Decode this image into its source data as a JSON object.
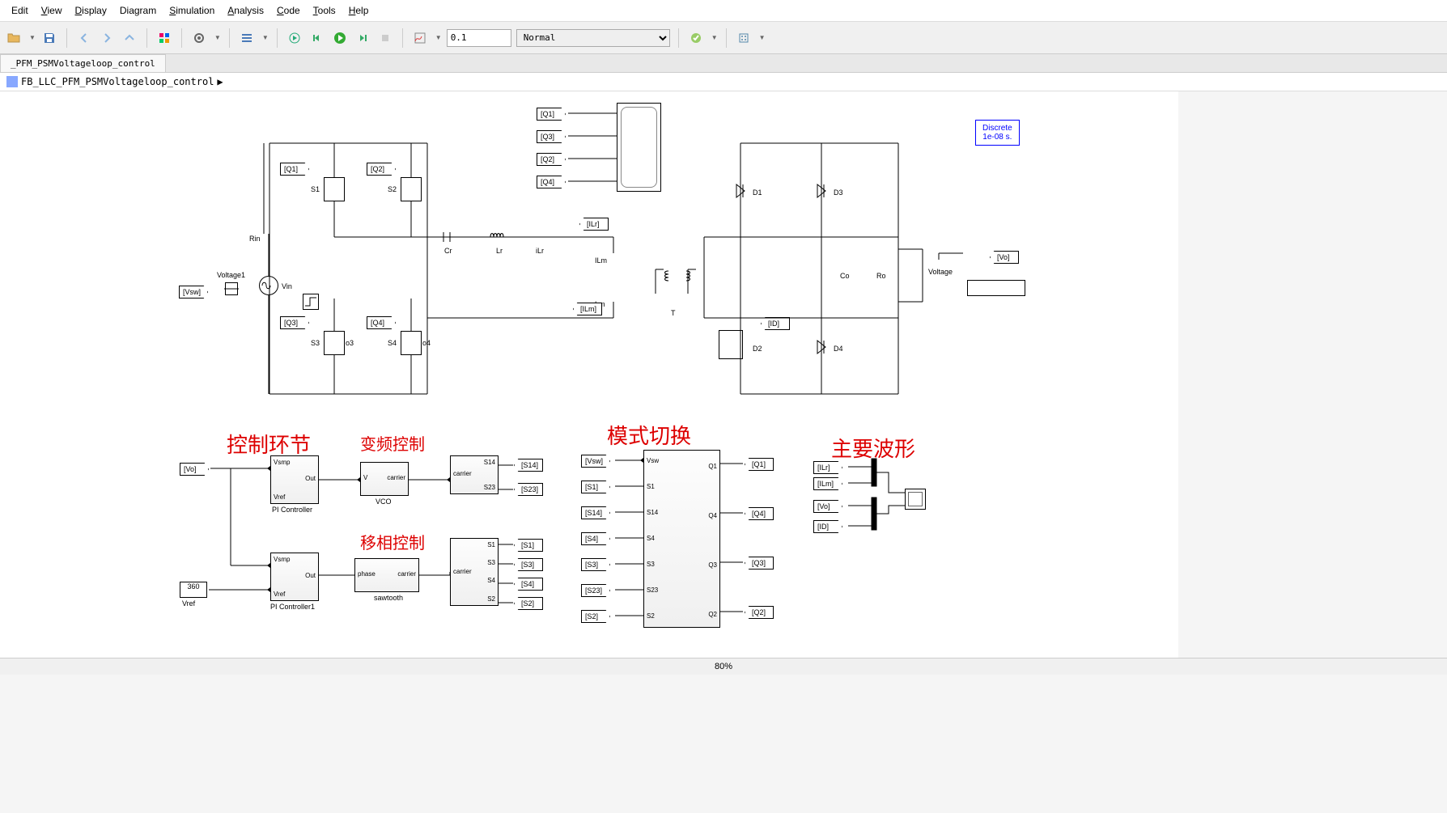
{
  "menu": {
    "edit": "Edit",
    "view": "View",
    "display": "Display",
    "diagram": "Diagram",
    "simulation": "Simulation",
    "analysis": "Analysis",
    "code": "Code",
    "tools": "Tools",
    "help": "Help"
  },
  "toolbar": {
    "stop_time": "0.1",
    "mode": "Normal"
  },
  "tab": "_PFM_PSMVoltageloop_control",
  "breadcrumb": "FB_LLC_PFM_PSMVoltageloop_control",
  "statusbar": {
    "zoom": "80%"
  },
  "labels": {
    "control_loop": "控制环节",
    "vfc": "变频控制",
    "psc": "移相控制",
    "mode_switch": "模式切换",
    "main_waveform": "主要波形"
  },
  "tags": {
    "q1": "[Q1]",
    "q2": "[Q2]",
    "q3": "[Q3]",
    "q4": "[Q4]",
    "vsw": "[Vsw]",
    "vo": "[Vo]",
    "ilr": "[ILr]",
    "ilm": "[ILm]",
    "id": "[ID]",
    "s1": "[S1]",
    "s2": "[S2]",
    "s3": "[S3]",
    "s4": "[S4]",
    "s14": "[S14]",
    "s23": "[S23]"
  },
  "blocks": {
    "voltage1": "Voltage1",
    "vin": "Vin",
    "rin": "Rin",
    "s1": "S1",
    "s2": "S2",
    "s3": "S3",
    "s4": "S4",
    "o3": "o3",
    "o4": "o4",
    "cr": "Cr",
    "lr": "Lr",
    "ilr": "iLr",
    "ilm": "ILm",
    "lm": "Lm",
    "t": "T",
    "d1": "D1",
    "d2": "D2",
    "d3": "D3",
    "d4": "D4",
    "co": "Co",
    "ro": "Ro",
    "voltage": "Voltage",
    "pi_controller": "PI Controller",
    "pi_controller1": "PI Controller1",
    "vco": "VCO",
    "sawtooth": "sawtooth",
    "vsmp": "Vsmp",
    "vref": "Vref",
    "out": "Out",
    "v_port": "V",
    "carrier_port": "carrier",
    "phase_port": "phase",
    "vref_const": "360",
    "vsw_port": "Vsw",
    "s14_port": "S14",
    "s23_port": "S23",
    "q_out1": "Q1",
    "q_out2": "Q2",
    "q_out3": "Q3",
    "q_out4": "Q4"
  },
  "discrete": {
    "line1": "Discrete",
    "line2": "1e-08 s."
  }
}
